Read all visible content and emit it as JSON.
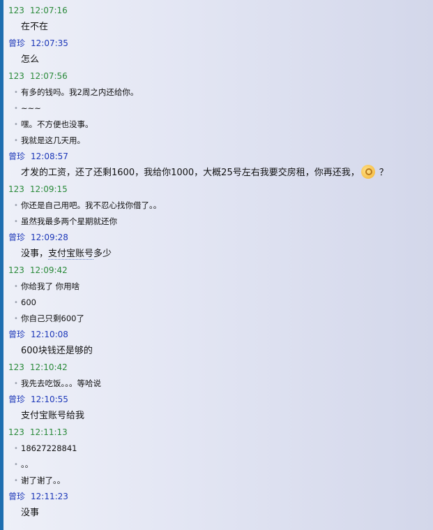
{
  "conversation": [
    {
      "sender": "123",
      "time": "12:07:16",
      "style": "a",
      "size": "big",
      "messages": [
        "在不在"
      ]
    },
    {
      "sender": "曾珍",
      "time": "12:07:35",
      "style": "b",
      "size": "big",
      "messages": [
        "怎么"
      ]
    },
    {
      "sender": "123",
      "time": "12:07:56",
      "style": "a",
      "size": "small",
      "messages": [
        "有多的钱吗。我2周之内还给你。",
        "~~~",
        "嘿。不方便也没事。",
        "我就是这几天用。"
      ]
    },
    {
      "sender": "曾珍",
      "time": "12:08:57",
      "style": "b",
      "size": "big",
      "rich": true,
      "text_before": "才发的工资，还了还剩1600，我给你1000，大概25号左右我要交房租，你再还我，",
      "emoji": "ok-hand-emoji-icon",
      "text_after": "？"
    },
    {
      "sender": "123",
      "time": "12:09:15",
      "style": "a",
      "size": "small",
      "messages": [
        "你还是自己用吧。我不忍心找你借了。。",
        "虽然我最多两个星期就还你"
      ]
    },
    {
      "sender": "曾珍",
      "time": "12:09:28",
      "style": "b",
      "size": "big",
      "rich2": true,
      "part1": "没事，",
      "part2": "支付宝账号",
      "part3": "多少"
    },
    {
      "sender": "123",
      "time": "12:09:42",
      "style": "a",
      "size": "small",
      "messages": [
        "你给我了 你用啥",
        "600",
        "你自己只剩600了"
      ]
    },
    {
      "sender": "曾珍",
      "time": "12:10:08",
      "style": "b",
      "size": "big",
      "messages": [
        "600块钱还是够的"
      ]
    },
    {
      "sender": "123",
      "time": "12:10:42",
      "style": "a",
      "size": "small",
      "messages": [
        "我先去吃饭。。。等哈说"
      ]
    },
    {
      "sender": "曾珍",
      "time": "12:10:55",
      "style": "b",
      "size": "big",
      "messages": [
        "支付宝账号给我"
      ]
    },
    {
      "sender": "123",
      "time": "12:11:13",
      "style": "a",
      "size": "small",
      "messages": [
        "18627228841",
        "。。",
        "谢了谢了。。"
      ]
    },
    {
      "sender": "曾珍",
      "time": "12:11:23",
      "style": "b",
      "size": "big",
      "messages": [
        "没事"
      ]
    }
  ],
  "colors": {
    "sender_a": "#2a8a3a",
    "sender_b": "#1c37b8",
    "left_bar": "#1f6fb0"
  },
  "bullet_glyph": "•"
}
